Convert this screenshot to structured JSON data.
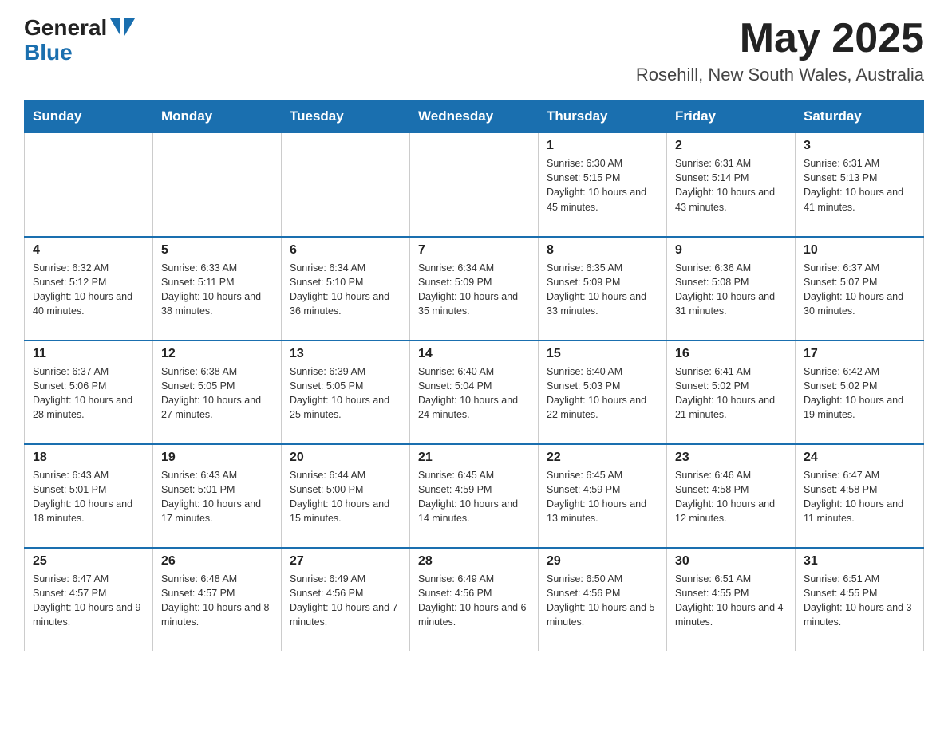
{
  "header": {
    "logo_general": "General",
    "logo_blue": "Blue",
    "month_year": "May 2025",
    "location": "Rosehill, New South Wales, Australia"
  },
  "days_of_week": [
    "Sunday",
    "Monday",
    "Tuesday",
    "Wednesday",
    "Thursday",
    "Friday",
    "Saturday"
  ],
  "weeks": [
    [
      {
        "day": "",
        "info": ""
      },
      {
        "day": "",
        "info": ""
      },
      {
        "day": "",
        "info": ""
      },
      {
        "day": "",
        "info": ""
      },
      {
        "day": "1",
        "info": "Sunrise: 6:30 AM\nSunset: 5:15 PM\nDaylight: 10 hours and 45 minutes."
      },
      {
        "day": "2",
        "info": "Sunrise: 6:31 AM\nSunset: 5:14 PM\nDaylight: 10 hours and 43 minutes."
      },
      {
        "day": "3",
        "info": "Sunrise: 6:31 AM\nSunset: 5:13 PM\nDaylight: 10 hours and 41 minutes."
      }
    ],
    [
      {
        "day": "4",
        "info": "Sunrise: 6:32 AM\nSunset: 5:12 PM\nDaylight: 10 hours and 40 minutes."
      },
      {
        "day": "5",
        "info": "Sunrise: 6:33 AM\nSunset: 5:11 PM\nDaylight: 10 hours and 38 minutes."
      },
      {
        "day": "6",
        "info": "Sunrise: 6:34 AM\nSunset: 5:10 PM\nDaylight: 10 hours and 36 minutes."
      },
      {
        "day": "7",
        "info": "Sunrise: 6:34 AM\nSunset: 5:09 PM\nDaylight: 10 hours and 35 minutes."
      },
      {
        "day": "8",
        "info": "Sunrise: 6:35 AM\nSunset: 5:09 PM\nDaylight: 10 hours and 33 minutes."
      },
      {
        "day": "9",
        "info": "Sunrise: 6:36 AM\nSunset: 5:08 PM\nDaylight: 10 hours and 31 minutes."
      },
      {
        "day": "10",
        "info": "Sunrise: 6:37 AM\nSunset: 5:07 PM\nDaylight: 10 hours and 30 minutes."
      }
    ],
    [
      {
        "day": "11",
        "info": "Sunrise: 6:37 AM\nSunset: 5:06 PM\nDaylight: 10 hours and 28 minutes."
      },
      {
        "day": "12",
        "info": "Sunrise: 6:38 AM\nSunset: 5:05 PM\nDaylight: 10 hours and 27 minutes."
      },
      {
        "day": "13",
        "info": "Sunrise: 6:39 AM\nSunset: 5:05 PM\nDaylight: 10 hours and 25 minutes."
      },
      {
        "day": "14",
        "info": "Sunrise: 6:40 AM\nSunset: 5:04 PM\nDaylight: 10 hours and 24 minutes."
      },
      {
        "day": "15",
        "info": "Sunrise: 6:40 AM\nSunset: 5:03 PM\nDaylight: 10 hours and 22 minutes."
      },
      {
        "day": "16",
        "info": "Sunrise: 6:41 AM\nSunset: 5:02 PM\nDaylight: 10 hours and 21 minutes."
      },
      {
        "day": "17",
        "info": "Sunrise: 6:42 AM\nSunset: 5:02 PM\nDaylight: 10 hours and 19 minutes."
      }
    ],
    [
      {
        "day": "18",
        "info": "Sunrise: 6:43 AM\nSunset: 5:01 PM\nDaylight: 10 hours and 18 minutes."
      },
      {
        "day": "19",
        "info": "Sunrise: 6:43 AM\nSunset: 5:01 PM\nDaylight: 10 hours and 17 minutes."
      },
      {
        "day": "20",
        "info": "Sunrise: 6:44 AM\nSunset: 5:00 PM\nDaylight: 10 hours and 15 minutes."
      },
      {
        "day": "21",
        "info": "Sunrise: 6:45 AM\nSunset: 4:59 PM\nDaylight: 10 hours and 14 minutes."
      },
      {
        "day": "22",
        "info": "Sunrise: 6:45 AM\nSunset: 4:59 PM\nDaylight: 10 hours and 13 minutes."
      },
      {
        "day": "23",
        "info": "Sunrise: 6:46 AM\nSunset: 4:58 PM\nDaylight: 10 hours and 12 minutes."
      },
      {
        "day": "24",
        "info": "Sunrise: 6:47 AM\nSunset: 4:58 PM\nDaylight: 10 hours and 11 minutes."
      }
    ],
    [
      {
        "day": "25",
        "info": "Sunrise: 6:47 AM\nSunset: 4:57 PM\nDaylight: 10 hours and 9 minutes."
      },
      {
        "day": "26",
        "info": "Sunrise: 6:48 AM\nSunset: 4:57 PM\nDaylight: 10 hours and 8 minutes."
      },
      {
        "day": "27",
        "info": "Sunrise: 6:49 AM\nSunset: 4:56 PM\nDaylight: 10 hours and 7 minutes."
      },
      {
        "day": "28",
        "info": "Sunrise: 6:49 AM\nSunset: 4:56 PM\nDaylight: 10 hours and 6 minutes."
      },
      {
        "day": "29",
        "info": "Sunrise: 6:50 AM\nSunset: 4:56 PM\nDaylight: 10 hours and 5 minutes."
      },
      {
        "day": "30",
        "info": "Sunrise: 6:51 AM\nSunset: 4:55 PM\nDaylight: 10 hours and 4 minutes."
      },
      {
        "day": "31",
        "info": "Sunrise: 6:51 AM\nSunset: 4:55 PM\nDaylight: 10 hours and 3 minutes."
      }
    ]
  ]
}
